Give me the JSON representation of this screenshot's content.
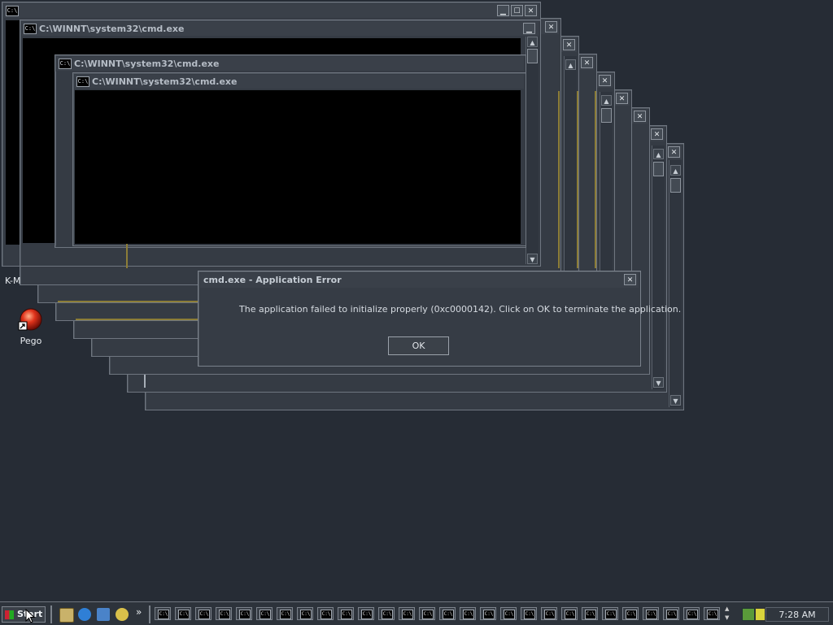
{
  "windows": {
    "icon_glyph": "C:\\",
    "cmd_title": "C:\\WINNT\\system32\\cmd.exe",
    "minimize_glyph": "▁",
    "maximize_glyph": "☐",
    "close_glyph": "✕",
    "scroll_up_glyph": "▲",
    "scroll_down_glyph": "▼"
  },
  "desktop": {
    "icons": [
      {
        "label": "K-M",
        "icon": "desktop-shortcut"
      },
      {
        "label": "Pego",
        "icon": "red-orb-icon"
      }
    ]
  },
  "error_dialog": {
    "title": "cmd.exe - Application Error",
    "message": "The application failed to initialize properly (0xc0000142). Click on OK to terminate the application.",
    "ok_label": "OK",
    "close_glyph": "✕"
  },
  "taskbar": {
    "start_label": "Start",
    "quick_launch": [
      "desktop-icon",
      "ie-icon",
      "outlook-icon",
      "search-icon"
    ],
    "more_glyph": "»",
    "task_glyph": "C:\\",
    "task_count": 28,
    "clock": "7:28 AM"
  },
  "colors": {
    "desktop": "#262c35",
    "window": "#353b44",
    "accent_line": "#8c7d38"
  }
}
